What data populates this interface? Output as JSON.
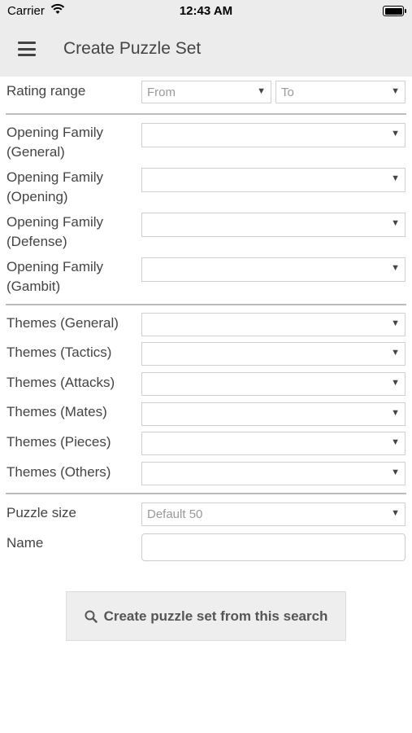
{
  "status_bar": {
    "carrier": "Carrier",
    "time": "12:43 AM"
  },
  "nav": {
    "title": "Create Puzzle Set"
  },
  "rating": {
    "label": "Rating range",
    "from": "From",
    "to": "To"
  },
  "openings": [
    {
      "line1": "Opening Family",
      "line2": "(General)",
      "value": ""
    },
    {
      "line1": "Opening Family",
      "line2": "(Opening)",
      "value": ""
    },
    {
      "line1": "Opening Family",
      "line2": "(Defense)",
      "value": ""
    },
    {
      "line1": "Opening Family",
      "line2": "(Gambit)",
      "value": ""
    }
  ],
  "themes": [
    {
      "label": "Themes (General)",
      "value": ""
    },
    {
      "label": "Themes (Tactics)",
      "value": ""
    },
    {
      "label": "Themes (Attacks)",
      "value": ""
    },
    {
      "label": "Themes (Mates)",
      "value": ""
    },
    {
      "label": "Themes (Pieces)",
      "value": ""
    },
    {
      "label": "Themes (Others)",
      "value": ""
    }
  ],
  "puzzle_size": {
    "label": "Puzzle size",
    "value": "Default 50"
  },
  "name": {
    "label": "Name",
    "value": ""
  },
  "submit": {
    "label": "Create puzzle set from this search",
    "icon": "search-icon"
  }
}
